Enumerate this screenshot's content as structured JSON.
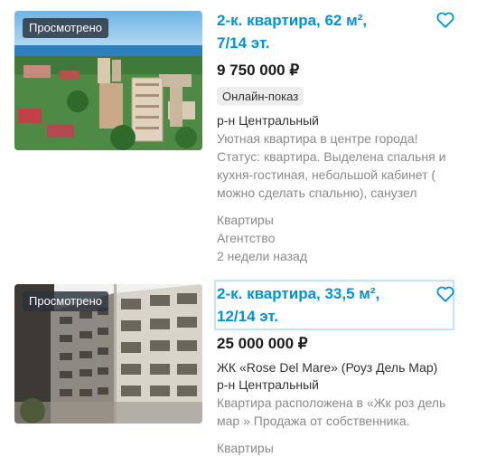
{
  "listings": [
    {
      "badge": "Просмотрено",
      "title_line1": "2-к. квартира, 62 м²,",
      "title_line2": "7/14 эт.",
      "price": "9 750 000 ₽",
      "online_badge": "Онлайн-показ",
      "district": "р-н Центральный",
      "description_lines": [
        "Уютная квартира в центре города!",
        "Статус: квартира. Выделена спальня и",
        "кухня-гостиная, небольшой кабинет (",
        "можно сделать спальню), санузел"
      ],
      "category": "Квартиры",
      "seller": "Агентство",
      "date": "2 недели назад"
    },
    {
      "badge": "Просмотрено",
      "title_line1": "2-к. квартира, 33,5 м²,",
      "title_line2": "12/14 эт.",
      "price": "25 000 000 ₽",
      "complex": "ЖК «Rose Del Mare» (Роуз Дель Мар)",
      "district": "р-н Центральный",
      "description_lines": [
        "Квартира расположена в «Жк роз дель",
        "мар » Продажа от собственника."
      ],
      "category": "Квартиры"
    }
  ],
  "colors": {
    "title": "#0094d6",
    "muted": "#8a8a8a",
    "badge_bg": "#2b323c"
  },
  "icons": {
    "favorite": "heart-outline-icon"
  }
}
